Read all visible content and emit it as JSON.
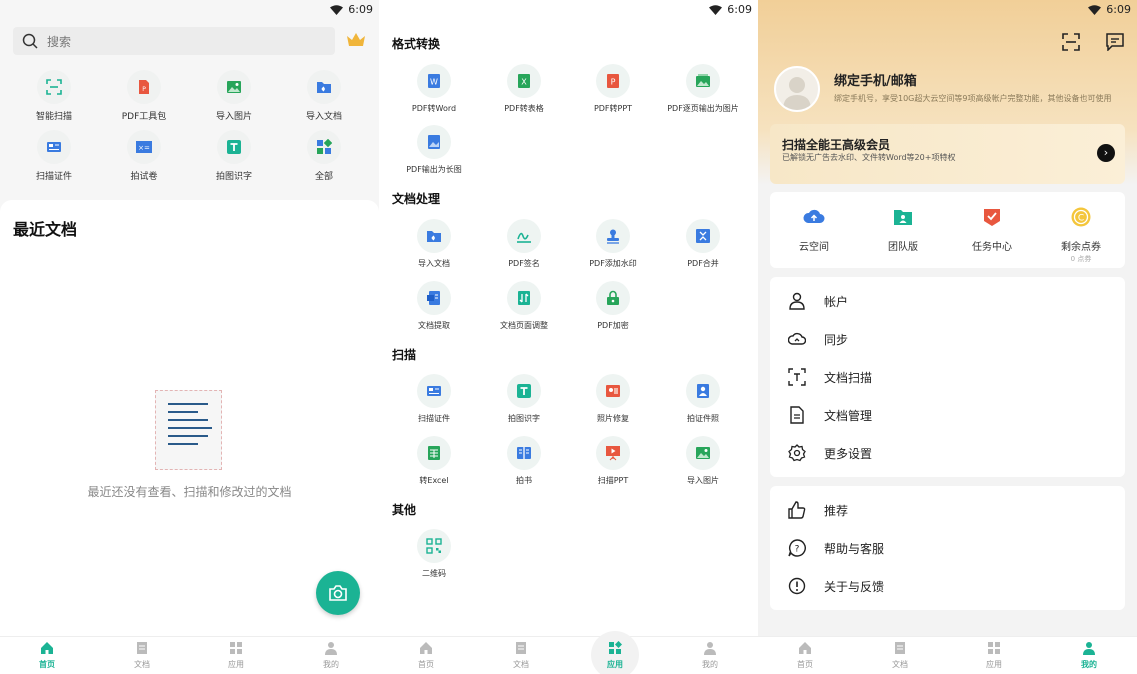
{
  "status": {
    "time": "6:09"
  },
  "screen1": {
    "search_placeholder": "搜索",
    "tools": [
      {
        "label": "智能扫描",
        "icon": "smart-scan-icon"
      },
      {
        "label": "PDF工具包",
        "icon": "pdf-toolkit-icon"
      },
      {
        "label": "导入图片",
        "icon": "import-image-icon"
      },
      {
        "label": "导入文档",
        "icon": "import-document-icon"
      },
      {
        "label": "扫描证件",
        "icon": "scan-id-icon"
      },
      {
        "label": "拍试卷",
        "icon": "scan-exam-icon"
      },
      {
        "label": "拍图识字",
        "icon": "ocr-text-icon"
      },
      {
        "label": "全部",
        "icon": "all-apps-icon"
      }
    ],
    "recent_title": "最近文档",
    "empty_text": "最近还没有查看、扫描和修改过的文档",
    "tab_active": "首页"
  },
  "screen2": {
    "sections": [
      {
        "title": "格式转换",
        "items": [
          "PDF转Word",
          "PDF转表格",
          "PDF转PPT",
          "PDF逐页输出为图片",
          "PDF输出为长图"
        ]
      },
      {
        "title": "文档处理",
        "items": [
          "导入文档",
          "PDF签名",
          "PDF添加水印",
          "PDF合并",
          "文档提取",
          "文档页面调整",
          "PDF加密"
        ]
      },
      {
        "title": "扫描",
        "items": [
          "扫描证件",
          "拍图识字",
          "照片修复",
          "拍证件照",
          "转Excel",
          "拍书",
          "扫描PPT",
          "导入图片"
        ]
      },
      {
        "title": "其他",
        "items": [
          "二维码"
        ]
      }
    ],
    "tab_active": "应用"
  },
  "screen3": {
    "bind_title": "绑定手机/邮箱",
    "bind_sub": "绑定手机号，享受10G超大云空间等9项高级帐户完整功能，其他设备也可使用",
    "vip_title": "扫描全能王高级会员",
    "vip_sub": "已解锁无广告去水印、文件转Word等20+项特权",
    "quick": [
      {
        "label": "云空间",
        "sub": ""
      },
      {
        "label": "团队版",
        "sub": ""
      },
      {
        "label": "任务中心",
        "sub": ""
      },
      {
        "label": "剩余点券",
        "sub": "0 点券"
      }
    ],
    "menu1": [
      "帐户",
      "同步",
      "文档扫描",
      "文档管理",
      "更多设置"
    ],
    "menu2": [
      "推荐",
      "帮助与客服",
      "关于与反馈"
    ],
    "tab_active": "我的"
  },
  "tabs": [
    "首页",
    "文档",
    "应用",
    "我的"
  ],
  "colors": {
    "accent": "#1bb394",
    "vip_gold": "#f1cf98",
    "blue": "#3a7be0",
    "green": "#27a55a",
    "red": "#e8573f"
  }
}
